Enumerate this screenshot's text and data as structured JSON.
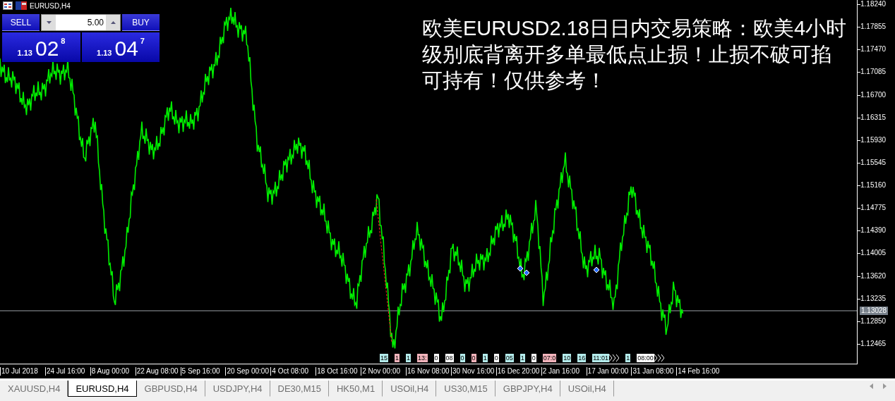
{
  "window": {
    "title": "EURUSD,H4"
  },
  "trade_panel": {
    "sell_label": "SELL",
    "buy_label": "BUY",
    "volume": "5.00",
    "sell_price": {
      "prefix": "1.13",
      "big": "02",
      "sup": "8"
    },
    "buy_price": {
      "prefix": "1.13",
      "big": "04",
      "sup": "7"
    }
  },
  "annotation": [
    "欧美EURUSD2.18日日内交易策略：欧美4小时",
    "级别底背离开多单最低点止损！止损不破可掐",
    "可持有！仅供参考！"
  ],
  "price_axis": {
    "ticks": [
      "1.18240",
      "1.17855",
      "1.17470",
      "1.17085",
      "1.16700",
      "1.16315",
      "1.15930",
      "1.15545",
      "1.15160",
      "1.14775",
      "1.14390",
      "1.14005",
      "1.13620",
      "1.13235",
      "1.12850",
      "1.12465"
    ],
    "current": "1.13028"
  },
  "time_axis": {
    "labels": [
      "10 Jul 2018",
      "24 Jul 16:00",
      "8 Aug 00:00",
      "22 Aug 08:00",
      "5 Sep 16:00",
      "20 Sep 00:00",
      "4 Oct 08:00",
      "18 Oct 16:00",
      "2 Nov 00:00",
      "16 Nov 08:00",
      "30 Nov 16:00",
      "16 Dec 20:00",
      "2 Jan 16:00",
      "17 Jan 00:00",
      "31 Jan 08:00",
      "14 Feb 16:00"
    ]
  },
  "events": [
    {
      "label": "15",
      "color": "#b4ecec",
      "arrow": false
    },
    {
      "label": "1",
      "color": "#f4b4bc",
      "arrow": false
    },
    {
      "label": "1",
      "color": "#b4ecec",
      "arrow": false
    },
    {
      "label": "13:",
      "color": "#f4b4bc",
      "arrow": false
    },
    {
      "label": "0",
      "color": "#ffffff",
      "arrow": false
    },
    {
      "label": "08",
      "color": "#ffffff",
      "arrow": false
    },
    {
      "label": "0",
      "color": "#b4ecec",
      "arrow": false
    },
    {
      "label": "0",
      "color": "#f4b4bc",
      "arrow": false
    },
    {
      "label": "1",
      "color": "#b4ecec",
      "arrow": false
    },
    {
      "label": "0",
      "color": "#ffffff",
      "arrow": false
    },
    {
      "label": "05",
      "color": "#b4ecec",
      "arrow": false
    },
    {
      "label": "1",
      "color": "#b4ecec",
      "arrow": false
    },
    {
      "label": "0",
      "color": "#ffffff",
      "arrow": false
    },
    {
      "label": "07:0",
      "color": "#f4b4bc",
      "arrow": false
    },
    {
      "label": "10",
      "color": "#b4ecec",
      "arrow": false
    },
    {
      "label": "16",
      "color": "#b4ecec",
      "arrow": false
    },
    {
      "label": "11:01",
      "color": "#b4ecec",
      "arrow": true
    },
    {
      "label": "1",
      "color": "#b4ecec",
      "arrow": false
    },
    {
      "label": "08:00",
      "color": "#ffffff",
      "arrow": true
    }
  ],
  "tabs": [
    {
      "label": "XAUUSD,H4",
      "selected": false
    },
    {
      "label": "EURUSD,H4",
      "selected": true
    },
    {
      "label": "GBPUSD,H4",
      "selected": false
    },
    {
      "label": "USDJPY,H4",
      "selected": false
    },
    {
      "label": "DE30,M15",
      "selected": false
    },
    {
      "label": "HK50,M1",
      "selected": false
    },
    {
      "label": "USOil,H4",
      "selected": false
    },
    {
      "label": "US30,M15",
      "selected": false
    },
    {
      "label": "GBPJPY,H4",
      "selected": false
    },
    {
      "label": "USOil,H4",
      "selected": false
    }
  ]
}
